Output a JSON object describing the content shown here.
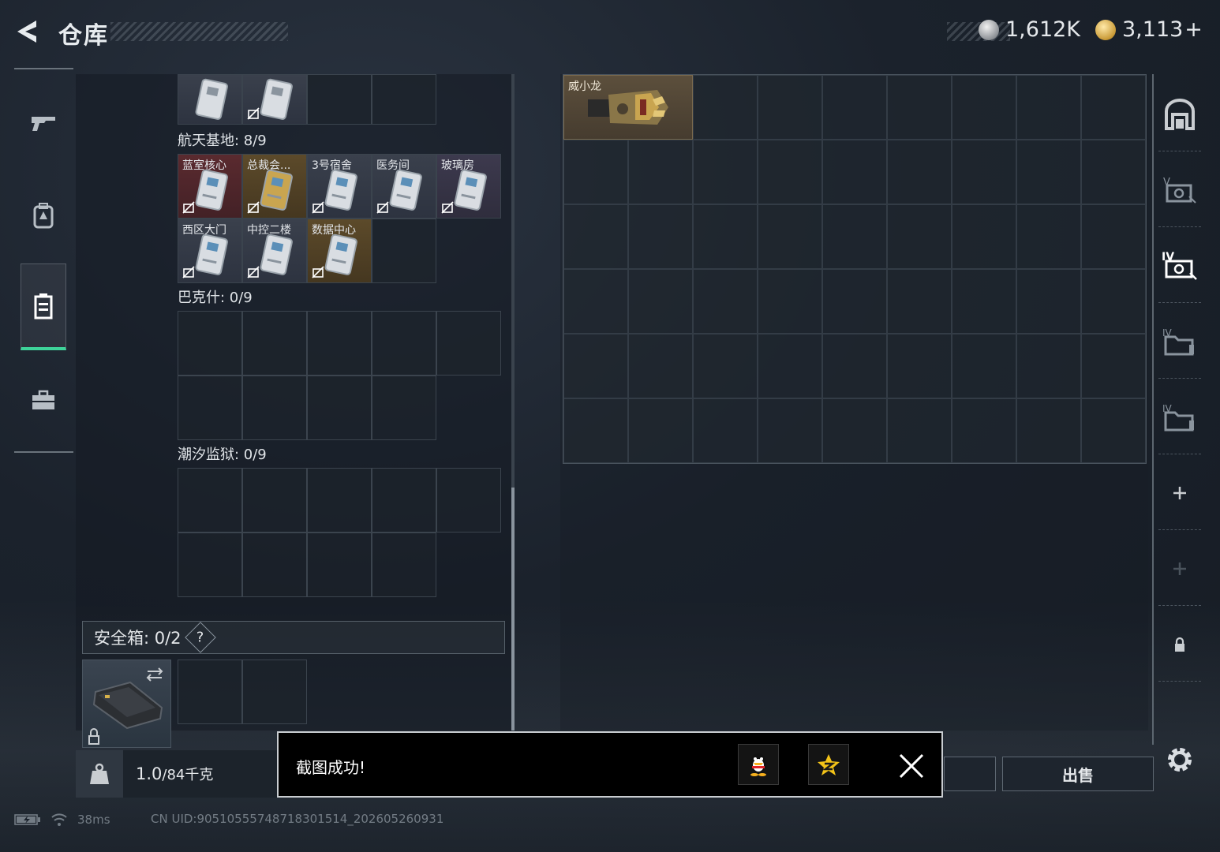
{
  "header": {
    "title": "仓库",
    "currency1": "1,612K",
    "currency2": "3,113",
    "add_label": "+"
  },
  "left_nav": {
    "items": [
      {
        "id": "weapons",
        "icon": "gun-icon"
      },
      {
        "id": "armor",
        "icon": "backpack-icon"
      },
      {
        "id": "keycards",
        "icon": "keycard-holder-icon",
        "active": true
      },
      {
        "id": "supplies",
        "icon": "toolbox-icon"
      }
    ]
  },
  "sections": {
    "top_row": {
      "labels": [
        "",
        ""
      ]
    },
    "space_base": {
      "title": "航天基地: 8/9",
      "cards": [
        {
          "label": "蓝室核心",
          "tier": "red"
        },
        {
          "label": "总裁会...",
          "tier": "gold"
        },
        {
          "label": "3号宿舍",
          "tier": "card"
        },
        {
          "label": "医务间",
          "tier": "card"
        },
        {
          "label": "玻璃房",
          "tier": "purple"
        },
        {
          "label": "西区大门",
          "tier": "card"
        },
        {
          "label": "中控二楼",
          "tier": "card"
        },
        {
          "label": "数据中心",
          "tier": "gold"
        }
      ]
    },
    "bakesh": {
      "title": "巴克什: 0/9"
    },
    "tide_prison": {
      "title": "潮汐监狱: 0/9"
    }
  },
  "safebox": {
    "label": "安全箱:  0/2",
    "help": "?"
  },
  "weight": {
    "value": "1.0",
    "total": "/84千克"
  },
  "right_grid": {
    "item_label": "威小龙"
  },
  "right_nav": {
    "items": [
      "storage-icon",
      "case-v-icon",
      "case-iv-icon",
      "folder-iv-icon",
      "folder-iv-icon-2",
      "add-icon",
      "add-disabled-icon",
      "lock-icon"
    ]
  },
  "actions": {
    "sell": "出售"
  },
  "toast": {
    "message": "截图成功!"
  },
  "status": {
    "ping": "38ms",
    "uid": "CN UID:90510555748718301514_202605260931"
  },
  "colors": {
    "accent": "#3ed39a",
    "background": "#1b222c",
    "red_tier": "#5a2a2f",
    "gold_tier": "#5c4a2a",
    "purple_tier": "#3d3a4e"
  }
}
